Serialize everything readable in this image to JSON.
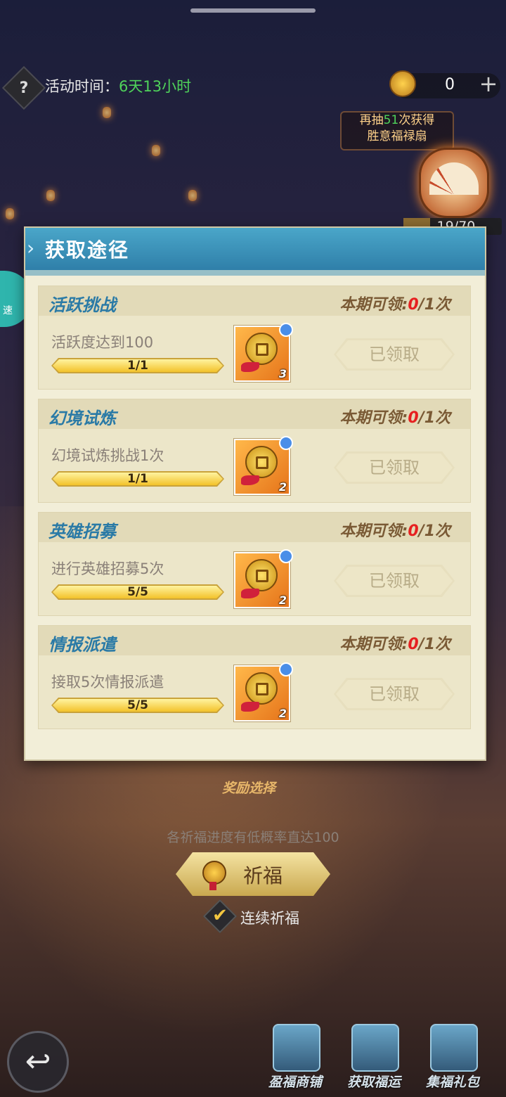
{
  "header": {
    "help_symbol": "?",
    "event_time_label": "活动时间：",
    "event_time_value": "6天13小时",
    "currency_value": "0",
    "plus_symbol": "+"
  },
  "fan_reward": {
    "hint_prefix": "再抽",
    "hint_count": "51",
    "hint_suffix": "次获得",
    "hint_item": "胜意福禄扇",
    "progress": "19/70",
    "progress_fraction": 0.27
  },
  "speed_badge": {
    "label": "速"
  },
  "modal": {
    "title": "获取途径",
    "tasks": [
      {
        "title": "活跃挑战",
        "limit_prefix": "本期可领:",
        "limit_current": "0",
        "limit_suffix": "/1次",
        "description": "活跃度达到100",
        "progress_text": "1/1",
        "progress_fraction": 1.0,
        "reward_qty": "3",
        "button": "已领取"
      },
      {
        "title": "幻境试炼",
        "limit_prefix": "本期可领:",
        "limit_current": "0",
        "limit_suffix": "/1次",
        "description": "幻境试炼挑战1次",
        "progress_text": "1/1",
        "progress_fraction": 1.0,
        "reward_qty": "2",
        "button": "已领取"
      },
      {
        "title": "英雄招募",
        "limit_prefix": "本期可领:",
        "limit_current": "0",
        "limit_suffix": "/1次",
        "description": "进行英雄招募5次",
        "progress_text": "5/5",
        "progress_fraction": 1.0,
        "reward_qty": "2",
        "button": "已领取"
      },
      {
        "title": "情报派遣",
        "limit_prefix": "本期可领:",
        "limit_current": "0",
        "limit_suffix": "/1次",
        "description": "接取5次情报派遣",
        "progress_text": "5/5",
        "progress_fraction": 1.0,
        "reward_qty": "2",
        "button": "已领取"
      }
    ]
  },
  "bottom": {
    "reward_select": "奖励选择",
    "tip": "各祈福进度有低概率直达100",
    "pray_button": "祈福",
    "continuous_label": "连续祈福",
    "check_symbol": "✔",
    "back_symbol": "↩"
  },
  "nav": [
    {
      "label": "盈福商铺"
    },
    {
      "label": "获取福运"
    },
    {
      "label": "集福礼包"
    }
  ],
  "colors": {
    "accent_blue": "#2a7aa6",
    "limit_red": "#e62020",
    "timer_green": "#4fd35a"
  }
}
